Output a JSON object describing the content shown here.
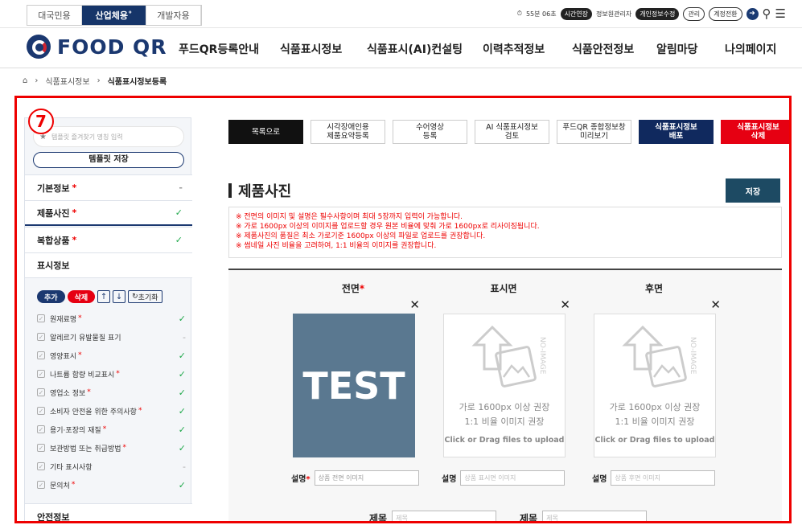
{
  "audience_tabs": [
    "대국민용",
    "산업체용˚",
    "개발자용"
  ],
  "util": {
    "timer": "55분 06초",
    "extend": "시간연장",
    "manager": "정보원관리자",
    "edit_profile": "개인정보수정",
    "manage": "관리",
    "switch_account": "계정전환"
  },
  "logo": "FOOD QR",
  "menu": [
    "푸드QR등록안내",
    "식품표시정보",
    "식품표시(AI)컨설팅",
    "이력추적정보",
    "식품안전정보",
    "알림마당",
    "나의페이지"
  ],
  "breadcrumb": [
    "식품표시정보",
    "식품표시정보등록"
  ],
  "callout": "7",
  "sidebar": {
    "search_placeholder": "템플릿 즐겨찾기 명칭 입력",
    "template_save": "템플릿 저장",
    "sections": [
      {
        "label": "기본정보",
        "req": "*",
        "status": "-"
      },
      {
        "label": "제품사진",
        "req": "*",
        "status": "✓"
      },
      {
        "label": "복합상품",
        "req": "*",
        "status": "✓"
      },
      {
        "label": "표시정보",
        "req": "",
        "status": ""
      }
    ],
    "controls": {
      "add": "추가",
      "delete": "삭제",
      "up": "↑",
      "down": "↓",
      "reset": "초기화"
    },
    "checks": [
      {
        "label": "원재료명",
        "req": "*",
        "status": "✓"
      },
      {
        "label": "알레르기 유발물질 표기",
        "req": "",
        "status": "-"
      },
      {
        "label": "영양표시",
        "req": "*",
        "status": "✓"
      },
      {
        "label": "나트륨 함량 비교표시",
        "req": "*",
        "status": "✓"
      },
      {
        "label": "영업소 정보",
        "req": "*",
        "status": "✓"
      },
      {
        "label": "소비자 안전을 위한 주의사항",
        "req": "*",
        "status": "✓"
      },
      {
        "label": "용기·포장의 재질",
        "req": "*",
        "status": "✓"
      },
      {
        "label": "보관방법 또는 취급방법",
        "req": "*",
        "status": "✓"
      },
      {
        "label": "기타 표시사항",
        "req": "",
        "status": "-"
      },
      {
        "label": "문의처",
        "req": "*",
        "status": "✓"
      }
    ],
    "bottom": "안전정보"
  },
  "toolbar": [
    "목록으로",
    "시각장애인용\n제품요약등록",
    "수어영상\n등록",
    "AI 식품표시정보\n검토",
    "푸드QR 종합정보창\n미리보기",
    "식품표시정보\n배포",
    "식품표시정보\n삭제"
  ],
  "section_title": "제품사진",
  "save": "저장",
  "notices": [
    "※ 전면의 이미지 및 설명은 필수사항이며 최대 5장까지 입력이 가능합니다.",
    "※ 가로 1600px 이상의 이미지를 업로드할 경우 원본 비율에 맞춰 가로 1600px로 리사이징됩니다.",
    "※ 제품사진의 품질은 최소 가로기준 1600px 이상의 파일로 업로드를 권장합니다.",
    "※ 썸네일 사진 비율을 고려하여, 1:1 비율의 이미지를 권장합니다."
  ],
  "photos": [
    {
      "title": "전면",
      "req": "*",
      "image": "TEST",
      "desc_label": "설명",
      "desc_req": "*",
      "desc_value": "상품 전면 이미지"
    },
    {
      "title": "표시면",
      "req": "",
      "noimg1": "가로 1600px 이상 권장",
      "noimg2": "1:1 비율 이미지 권장",
      "upload": "Click or Drag files to upload",
      "desc_label": "설명",
      "desc_req": "",
      "desc_placeholder": "상품 표시면 이미지"
    },
    {
      "title": "후면",
      "req": "",
      "noimg1": "가로 1600px 이상 권장",
      "noimg2": "1:1 비율 이미지 권장",
      "upload": "Click or Drag files to upload",
      "desc_label": "설명",
      "desc_req": "",
      "desc_placeholder": "상품 후면 이미지"
    }
  ],
  "jemok": {
    "label": "제목",
    "placeholder": "제목"
  },
  "colors": {
    "navy": "#1b3870",
    "red": "#e60012",
    "check": "#1ea84a",
    "save": "#1d4a63"
  }
}
